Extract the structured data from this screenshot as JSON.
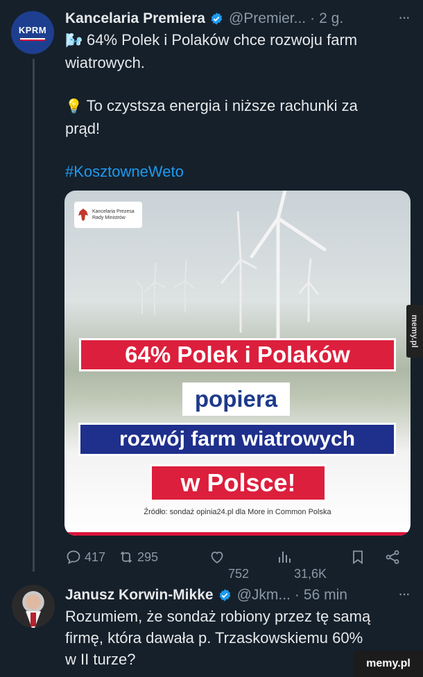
{
  "tweet1": {
    "avatar_text": "KPRM",
    "name": "Kancelaria Premiera",
    "handle": "@Premier...",
    "dot": "·",
    "time": "2 g.",
    "more": "···",
    "line1_emoji": "🌬️",
    "line1": "64% Polek i Polaków chce rozwoju farm",
    "line2": "wiatrowych.",
    "line3_emoji": "💡",
    "line3": "To czystsza energia i niższe rachunki za",
    "line4": "prąd!",
    "hashtag": "#KosztowneWeto",
    "card": {
      "logo_line1": "Kancelaria Prezesa",
      "logo_line2": "Rady Ministrów",
      "banner1": "64% Polek i Polaków",
      "banner2": "popiera",
      "banner3": "rozwój farm wiatrowych",
      "banner4": "w Polsce!",
      "source": "Źródło: sondaż opinia24.pl dla More in Common Polska"
    },
    "actions": {
      "reply_count": "417",
      "retweet_count": "295",
      "like_count": "752",
      "views_count": "31,6K"
    }
  },
  "tweet2": {
    "name": "Janusz Korwin-Mikke",
    "handle": "@Jkm...",
    "dot": "·",
    "time": "56 min",
    "more": "···",
    "line1": "Rozumiem, że sondaż robiony przez tę samą",
    "line2": "firmę, która dawała p. Trzaskowskiemu 60%",
    "line3": "w II turze?"
  },
  "watermark": {
    "side": "memy.pl",
    "bottom": "memy.pl"
  },
  "colors": {
    "background": "#15202b",
    "accent": "#1d9bf0",
    "muted": "#8b98a5",
    "verified": "#1d9bf0",
    "banner_red": "#dc1f3c",
    "banner_blue": "#1f2f8c"
  }
}
